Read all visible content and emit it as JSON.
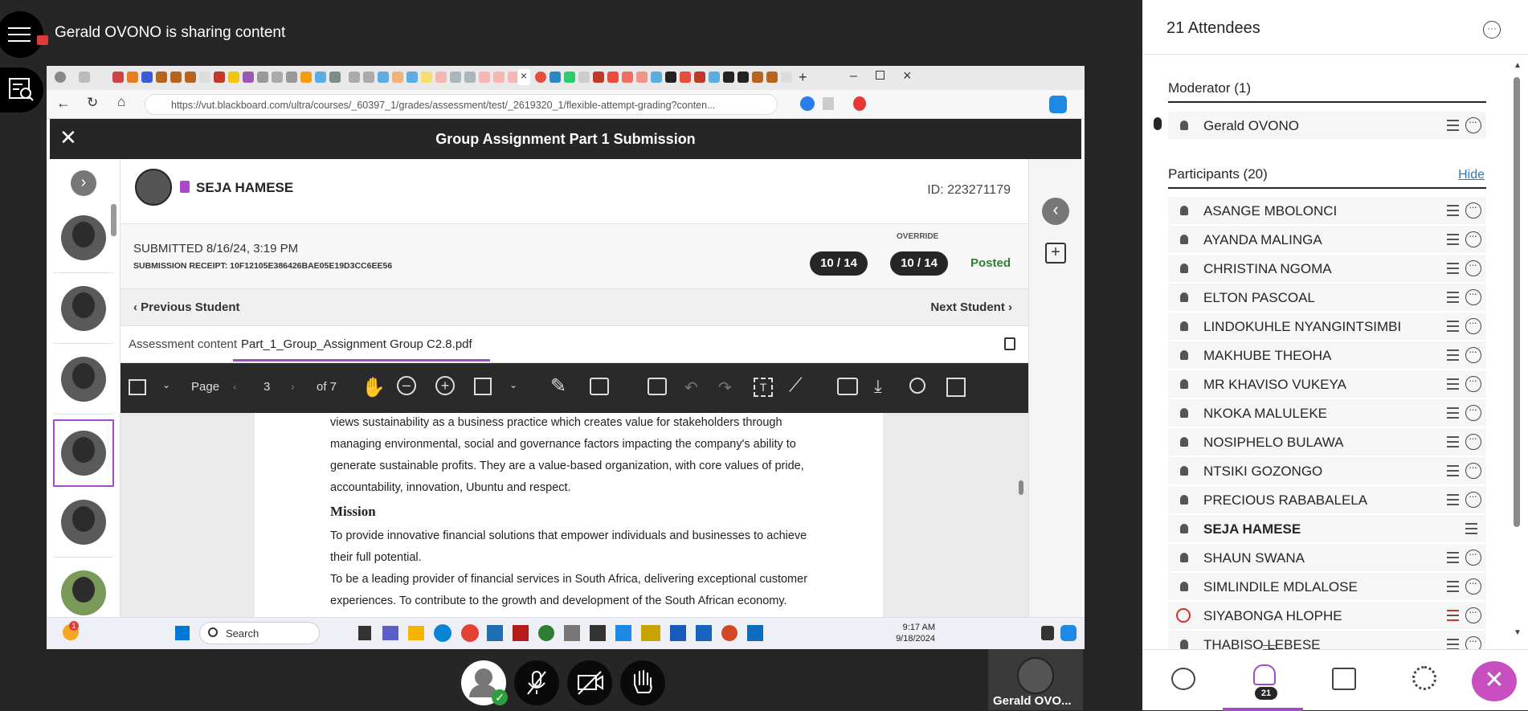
{
  "session": {
    "sharing_text": "Gerald OVONO is sharing content"
  },
  "browser": {
    "url": "https://vut.blackboard.com/ultra/courses/_60397_1/grades/assessment/test/_2619320_1/flexible-attempt-grading?conten..."
  },
  "blackboard": {
    "title": "Group Assignment Part 1 Submission",
    "student_name": "SEJA HAMESE",
    "student_id": "ID: 223271179",
    "submitted": "SUBMITTED 8/16/24, 3:19 PM",
    "receipt": "SUBMISSION RECEIPT: 10F12105E386426BAE05E19D3CC6EE56",
    "score": "10 / 14",
    "override_label": "OVERRIDE",
    "override_score": "10 / 14",
    "status": "Posted",
    "prev_student": "Previous Student",
    "next_student": "Next Student",
    "tab_assessment": "Assessment content",
    "tab_file": "Part_1_Group_Assignment Group C2.8.pdf",
    "page_label": "Page",
    "page_num": "3",
    "page_total": "of 7",
    "pdf_lines": [
      "views sustainability as a business practice which creates value for stakeholders through",
      "managing environmental, social and governance factors impacting the company's ability to",
      "generate sustainable profits. They are a value-based organization, with core values of pride,",
      "accountability, innovation, Ubuntu and respect.",
      "Mission",
      "To provide innovative financial solutions that empower individuals and businesses to achieve",
      "their full potential.",
      "To be a leading provider of financial services in South Africa, delivering exceptional customer",
      "experiences. To contribute to the growth and development of the South African economy."
    ]
  },
  "taskbar": {
    "search": "Search",
    "time": "9:17 AM",
    "date": "9/18/2024",
    "badge": "1"
  },
  "video_tile": {
    "name": "Gerald OVO..."
  },
  "panel": {
    "title": "21 Attendees",
    "moderator_header": "Moderator (1)",
    "moderator": "Gerald OVONO",
    "participants_header": "Participants (20)",
    "hide_link": "Hide",
    "participants": [
      "ASANGE MBOLONCI",
      "AYANDA MALINGA",
      "CHRISTINA NGOMA",
      "ELTON PASCOAL",
      "LINDOKUHLE NYANGINTSIMBI",
      "MAKHUBE THEOHA",
      "MR KHAVISO VUKEYA",
      "NKOKA MALULEKE",
      "NOSIPHELO BULAWA",
      "NTSIKI GOZONGO",
      "PRECIOUS RABABALELA",
      "SEJA HAMESE",
      "SHAUN SWANA",
      "SIMLINDILE MDLALOSE",
      "SIYABONGA HLOPHE",
      "THABISO LEBESE"
    ],
    "attendee_count_badge": "21"
  },
  "colors": {
    "accent": "#a64ac9",
    "posted": "#2e7d32",
    "link": "#2a7ab8",
    "danger": "#d32f2f"
  }
}
